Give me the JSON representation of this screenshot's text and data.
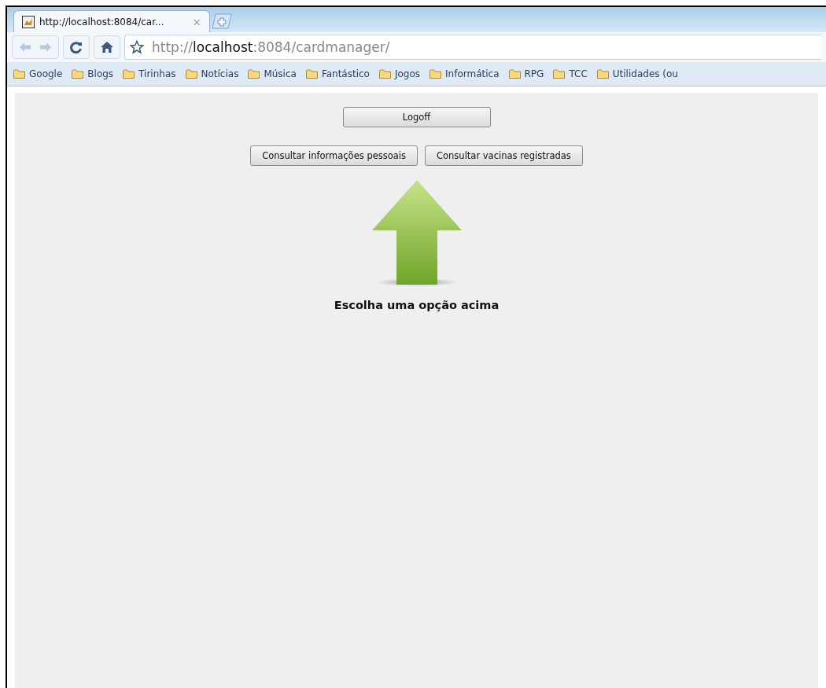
{
  "tabs": [
    {
      "title": "http://localhost:8084/car...",
      "close": "×",
      "selected": true
    }
  ],
  "address_bar": {
    "url": "http://**localhost**:8084/cardmanager/"
  },
  "bookmarks": [
    "Google",
    "Blogs",
    "Tirinhas",
    "Notícias",
    "Música",
    "Fantástico",
    "Jogos",
    "Informática",
    "RPG",
    "TCC",
    "Utilidades (ou"
  ],
  "page": {
    "logoff_button": "Logoff",
    "option_buttons": [
      "Consultar informações pessoais",
      "Consultar vacinas registradas"
    ],
    "message": "Escolha uma opção acima"
  }
}
